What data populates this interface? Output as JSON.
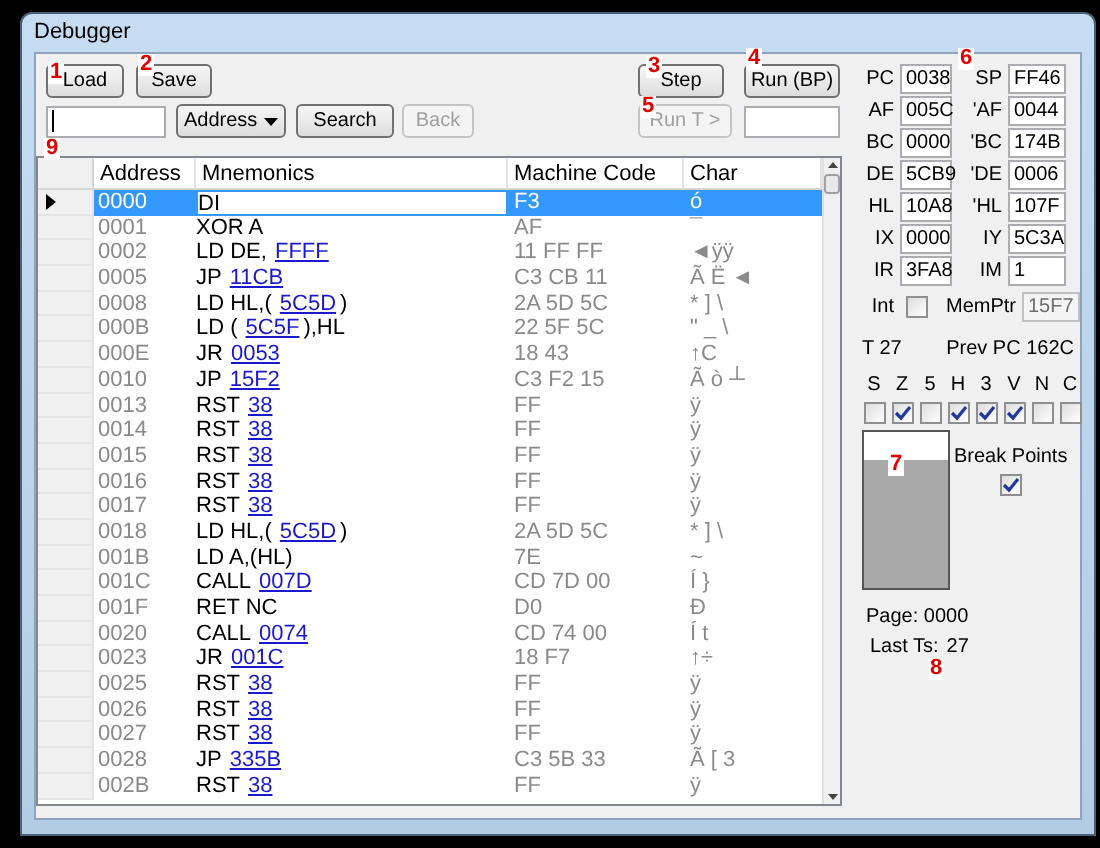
{
  "window": {
    "title": "Debugger"
  },
  "buttons": {
    "load": "Load",
    "save": "Save",
    "step": "Step",
    "run_bp": "Run (BP)",
    "search": "Search"
  },
  "search_mode": "Address",
  "back": {
    "label": "Back",
    "disabled": true
  },
  "run_t": {
    "label": "Run T >",
    "disabled": true
  },
  "grid": {
    "columns": [
      "Address",
      "Mnemonics",
      "Machine Code",
      "Char"
    ],
    "rows": [
      {
        "address": "0000",
        "op": "DI",
        "machine_code": "F3",
        "char": "ó",
        "selected": true
      },
      {
        "address": "0001",
        "op": "XOR A",
        "machine_code": "AF",
        "char": "¯",
        "selected": false
      },
      {
        "address": "0002",
        "op": "LD DE,",
        "operand": "FFFF",
        "machine_code": "11 FF FF",
        "char": "◄ÿÿ",
        "selected": false
      },
      {
        "address": "0005",
        "op": "JP",
        "operand": "11CB",
        "machine_code": "C3 CB 11",
        "char": "Ã Ë ◄",
        "selected": false
      },
      {
        "address": "0008",
        "op": "LD HL,(",
        "operand": "5C5D",
        "tail": ")",
        "machine_code": "2A 5D 5C",
        "char": "* ] \\",
        "selected": false
      },
      {
        "address": "000B",
        "op": "LD (",
        "operand": "5C5F",
        "tail": "),HL",
        "machine_code": "22 5F 5C",
        "char": "\" _ \\",
        "selected": false
      },
      {
        "address": "000E",
        "op": "JR",
        "operand": "0053",
        "machine_code": "18 43",
        "char": "↑C",
        "selected": false
      },
      {
        "address": "0010",
        "op": "JP",
        "operand": "15F2",
        "machine_code": "C3 F2 15",
        "char": "Ã ò ┴",
        "selected": false
      },
      {
        "address": "0013",
        "op": "RST",
        "operand": "38",
        "machine_code": "FF",
        "char": "ÿ",
        "selected": false
      },
      {
        "address": "0014",
        "op": "RST",
        "operand": "38",
        "machine_code": "FF",
        "char": "ÿ",
        "selected": false
      },
      {
        "address": "0015",
        "op": "RST",
        "operand": "38",
        "machine_code": "FF",
        "char": "ÿ",
        "selected": false
      },
      {
        "address": "0016",
        "op": "RST",
        "operand": "38",
        "machine_code": "FF",
        "char": "ÿ",
        "selected": false
      },
      {
        "address": "0017",
        "op": "RST",
        "operand": "38",
        "machine_code": "FF",
        "char": "ÿ",
        "selected": false
      },
      {
        "address": "0018",
        "op": "LD HL,(",
        "operand": "5C5D",
        "tail": ")",
        "machine_code": "2A 5D 5C",
        "char": "* ] \\",
        "selected": false
      },
      {
        "address": "001B",
        "op": "LD A,(HL)",
        "machine_code": "7E",
        "char": "~",
        "selected": false
      },
      {
        "address": "001C",
        "op": "CALL",
        "operand": "007D",
        "machine_code": "CD 7D 00",
        "char": "Í }",
        "selected": false
      },
      {
        "address": "001F",
        "op": "RET NC",
        "machine_code": "D0",
        "char": "Ð",
        "selected": false
      },
      {
        "address": "0020",
        "op": "CALL",
        "operand": "0074",
        "machine_code": "CD 74 00",
        "char": "Í t",
        "selected": false
      },
      {
        "address": "0023",
        "op": "JR",
        "operand": "001C",
        "machine_code": "18 F7",
        "char": "↑÷",
        "selected": false
      },
      {
        "address": "0025",
        "op": "RST",
        "operand": "38",
        "machine_code": "FF",
        "char": "ÿ",
        "selected": false
      },
      {
        "address": "0026",
        "op": "RST",
        "operand": "38",
        "machine_code": "FF",
        "char": "ÿ",
        "selected": false
      },
      {
        "address": "0027",
        "op": "RST",
        "operand": "38",
        "machine_code": "FF",
        "char": "ÿ",
        "selected": false
      },
      {
        "address": "0028",
        "op": "JP",
        "operand": "335B",
        "machine_code": "C3 5B 33",
        "char": "Ã [ 3",
        "selected": false
      },
      {
        "address": "002B",
        "op": "RST",
        "operand": "38",
        "machine_code": "FF",
        "char": "ÿ",
        "selected": false
      }
    ]
  },
  "registers": [
    {
      "name": "PC",
      "value": "0038"
    },
    {
      "name": "SP",
      "value": "FF46"
    },
    {
      "name": "AF",
      "value": "005C"
    },
    {
      "name": "'AF",
      "value": "0044"
    },
    {
      "name": "BC",
      "value": "0000"
    },
    {
      "name": "'BC",
      "value": "174B"
    },
    {
      "name": "DE",
      "value": "5CB9"
    },
    {
      "name": "'DE",
      "value": "0006"
    },
    {
      "name": "HL",
      "value": "10A8"
    },
    {
      "name": "'HL",
      "value": "107F"
    },
    {
      "name": "IX",
      "value": "0000"
    },
    {
      "name": "IY",
      "value": "5C3A"
    },
    {
      "name": "IR",
      "value": "3FA8"
    },
    {
      "name": "IM",
      "value": "1"
    }
  ],
  "int": {
    "label": "Int",
    "checked": false
  },
  "memptr": {
    "label": "MemPtr",
    "value": "15F7",
    "disabled": true
  },
  "t_states": "T 27",
  "prev_pc": "Prev PC 162C",
  "flags": [
    {
      "name": "S",
      "checked": false
    },
    {
      "name": "Z",
      "checked": true
    },
    {
      "name": "5",
      "checked": false
    },
    {
      "name": "H",
      "checked": true
    },
    {
      "name": "3",
      "checked": true
    },
    {
      "name": "V",
      "checked": true
    },
    {
      "name": "N",
      "checked": false
    },
    {
      "name": "C",
      "checked": false
    }
  ],
  "break_points": {
    "label": "Break Points",
    "checked": true
  },
  "page": "Page: 0000",
  "last_ts": {
    "label": "Last Ts:",
    "value": "27"
  },
  "annotations": [
    "1",
    "2",
    "3",
    "4",
    "5",
    "6",
    "7",
    "8",
    "9"
  ]
}
